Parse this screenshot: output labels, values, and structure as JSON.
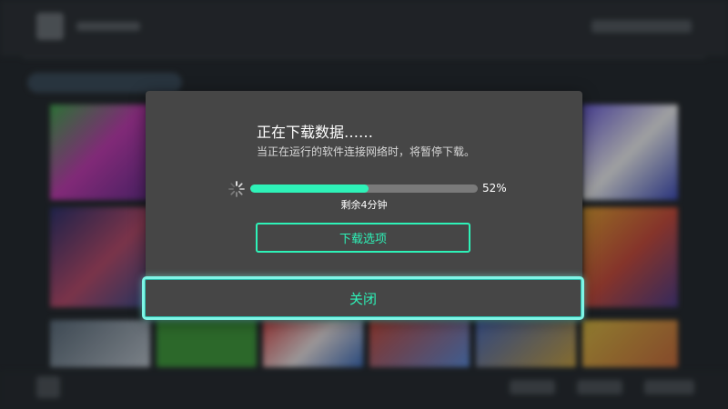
{
  "dialog": {
    "title": "正在下载数据……",
    "subtitle": "当正在运行的软件连接网络时，将暂停下载。",
    "progress": {
      "fraction": 0.52,
      "percent_label": "52%",
      "remaining_label": "剩余4分钟"
    },
    "options_button_label": "下载选项",
    "close_button_label": "关闭"
  },
  "colors": {
    "accent": "#2ef2b8",
    "focus_outline": "#7ff5e6",
    "dialog_bg": "#464646",
    "progress_track": "#7a7a7a"
  },
  "icons": {
    "spinner": "loading-spinner-icon"
  }
}
